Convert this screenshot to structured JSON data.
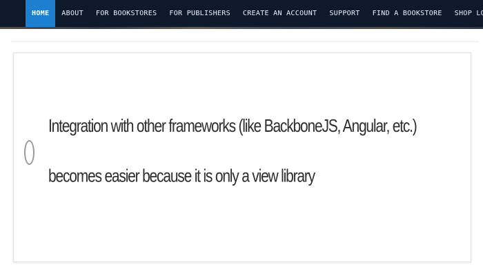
{
  "nav": {
    "items": [
      {
        "label": "HOME",
        "active": true
      },
      {
        "label": "ABOUT",
        "active": false
      },
      {
        "label": "FOR BOOKSTORES",
        "active": false
      },
      {
        "label": "FOR PUBLISHERS",
        "active": false
      },
      {
        "label": "CREATE AN ACCOUNT",
        "active": false
      },
      {
        "label": "SUPPORT",
        "active": false
      },
      {
        "label": "FIND A BOOKSTORE",
        "active": false
      },
      {
        "label": "SHOP LOCAL",
        "active": false
      }
    ],
    "colors": {
      "background": "#0c1a2b",
      "active_background": "#1d7fd0",
      "text": "#eef2f6"
    }
  },
  "option": {
    "text": "Integration with other frameworks (like BackboneJS, Angular, etc.) becomes easier because it is only a view library",
    "selected": false,
    "icon": "radio-unchecked-icon"
  }
}
